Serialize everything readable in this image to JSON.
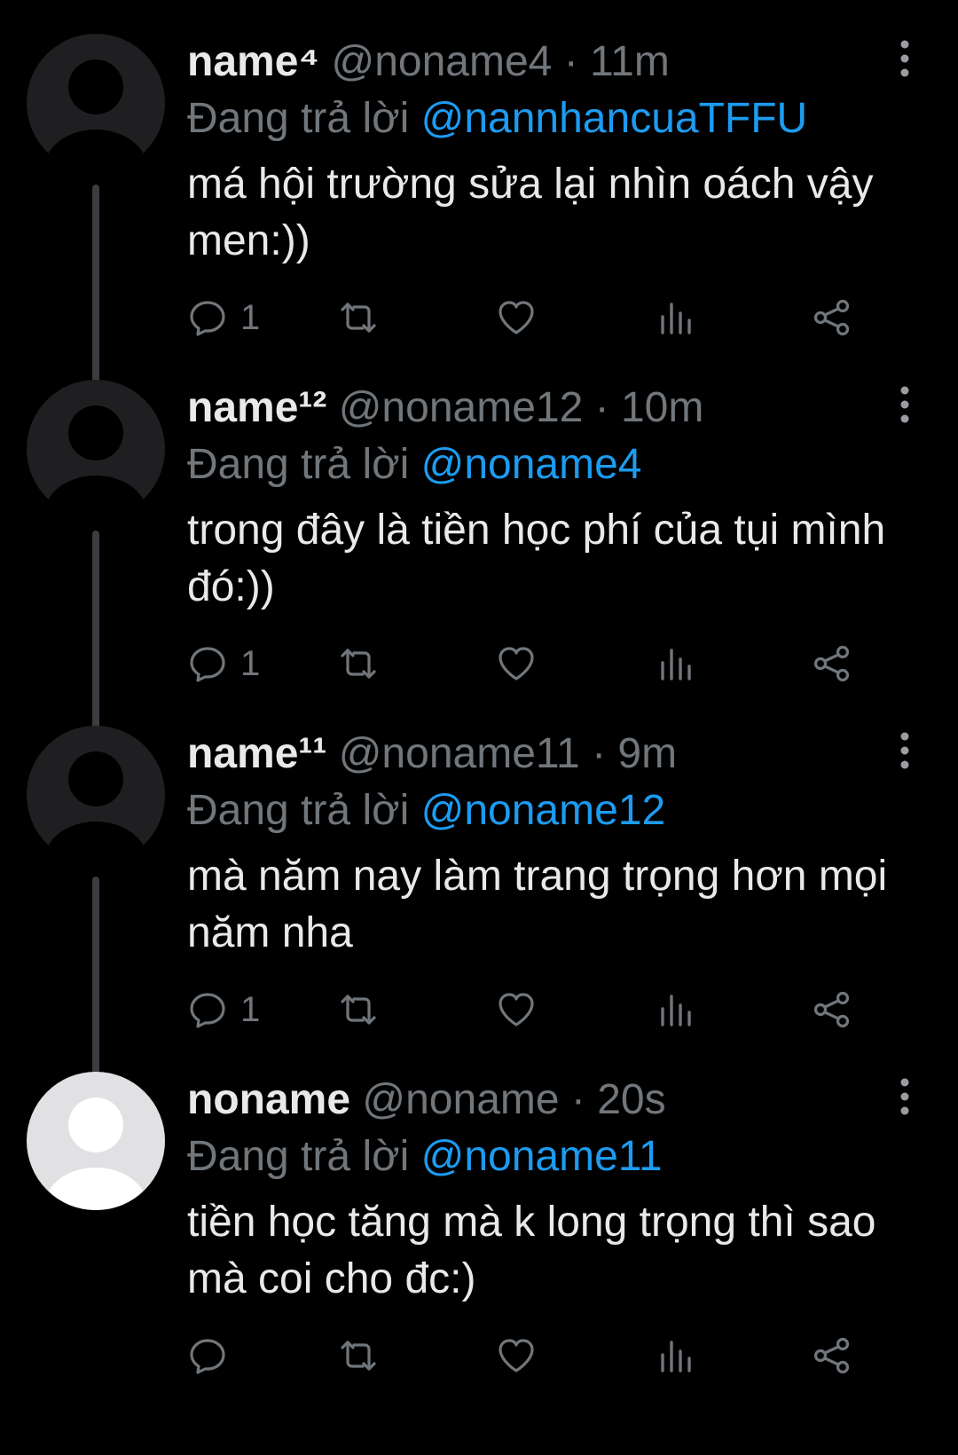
{
  "reply_prefix": "Đang trả lời",
  "tweets": [
    {
      "display_name": "name⁴",
      "handle": "@noname4",
      "time": "11m",
      "replying_to": "@nannhancuaTFFU",
      "text": "má hội trường sửa lại nhìn oách vậy men:))",
      "reply_count": "1",
      "avatar": "dark"
    },
    {
      "display_name": "name¹²",
      "handle": "@noname12",
      "time": "10m",
      "replying_to": "@noname4",
      "text": "trong đây là tiền học phí của tụi mình đó:))",
      "reply_count": "1",
      "avatar": "dark"
    },
    {
      "display_name": "name¹¹",
      "handle": "@noname11",
      "time": "9m",
      "replying_to": "@noname12",
      "text": "mà năm nay làm trang trọng hơn mọi năm nha",
      "reply_count": "1",
      "avatar": "dark"
    },
    {
      "display_name": "noname",
      "handle": "@noname",
      "time": "20s",
      "replying_to": "@noname11",
      "text": "tiền học tăng mà k long trọng thì sao mà coi cho đc:)",
      "reply_count": "",
      "avatar": "light"
    }
  ],
  "colors": {
    "background": "#000000",
    "text": "#e7e9ea",
    "muted": "#71767b",
    "link": "#1d9bf0",
    "thread_line": "#3a3d41",
    "avatar_dark_bg": "#1f1e21",
    "avatar_dark_fg": "#000000",
    "avatar_light_bg": "#e1e0e3",
    "avatar_light_fg": "#ffffff"
  },
  "icons": [
    "default-avatar-icon",
    "more-options-icon",
    "reply-icon",
    "retweet-icon",
    "like-icon",
    "views-icon",
    "share-icon"
  ]
}
